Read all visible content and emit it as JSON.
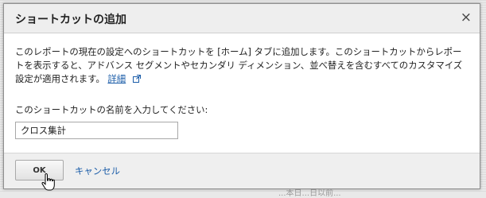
{
  "dialog": {
    "title": "ショートカットの追加",
    "close_symbol": "×",
    "description": "このレポートの現在の設定へのショートカットを [ホーム] タブに追加します。このショートカットからレポートを表示すると、アドバンス セグメントやセカンダリ ディメンション、並べ替えを含むすべてのカスタマイズ設定が適用されます。",
    "details_link": "詳細",
    "name_label": "このショートカットの名前を入力してください:",
    "name_value": "クロス集計",
    "ok_label": "OK",
    "cancel_label": "キャンセル"
  },
  "background": {
    "partial_text": "...本日...日以前..."
  },
  "icons": {
    "close": "close-icon",
    "external_link": "external-link-icon",
    "cursor": "hand-cursor-icon"
  },
  "colors": {
    "link": "#1a5ca8",
    "titlebar": "#eeeeee",
    "footer": "#efefef"
  }
}
